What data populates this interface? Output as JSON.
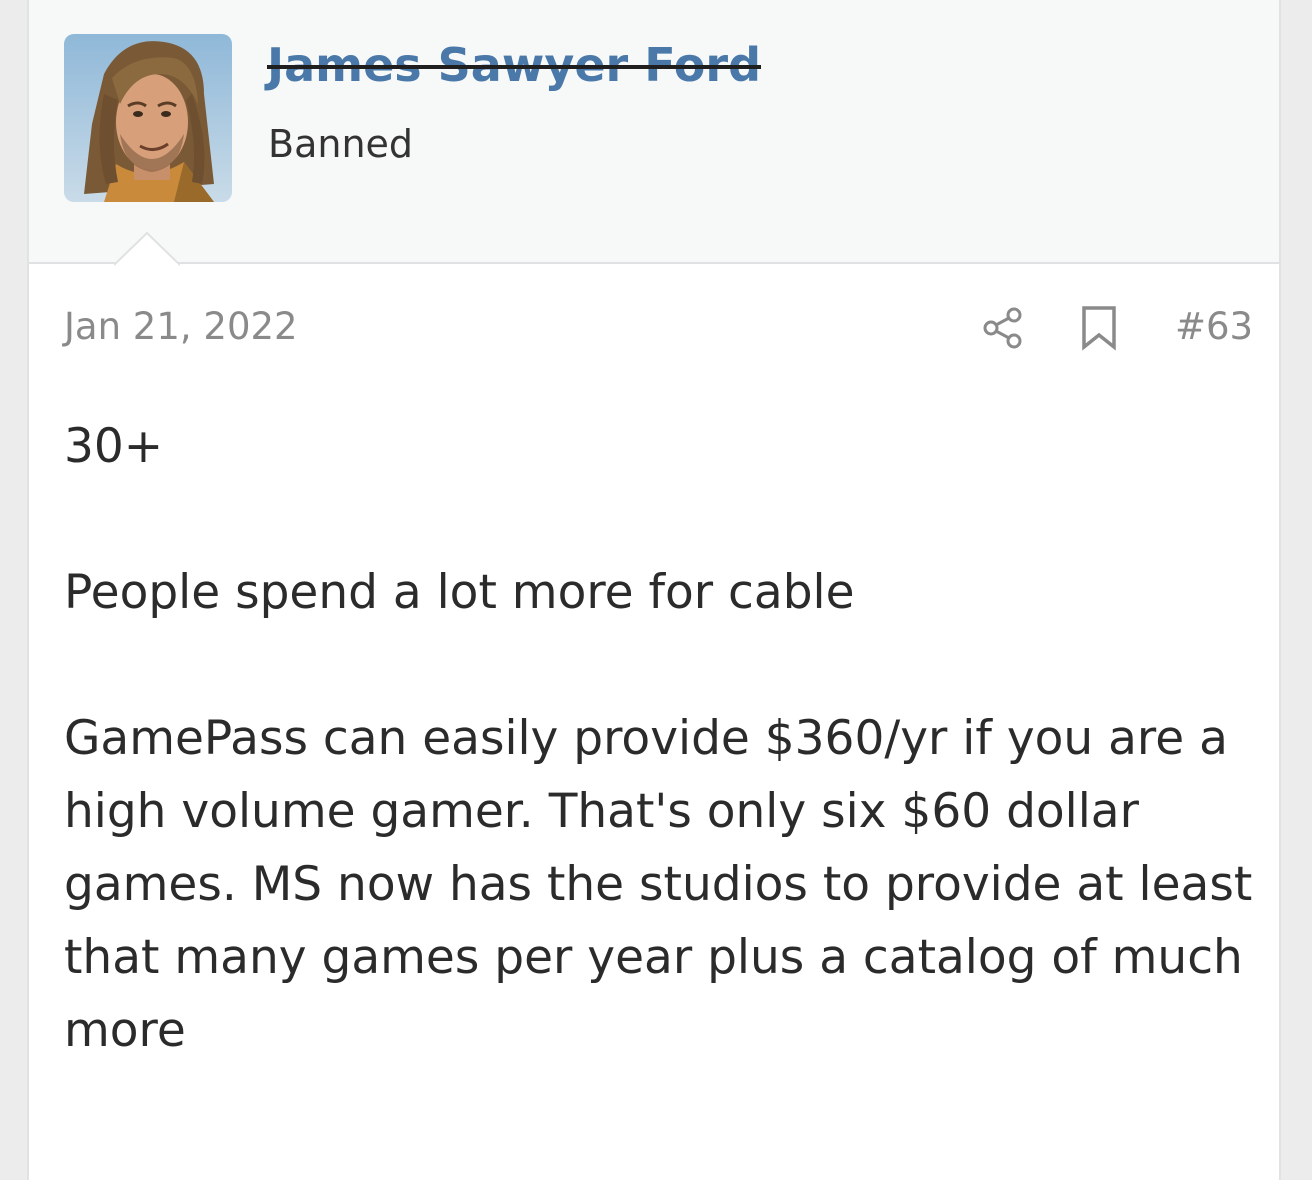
{
  "user": {
    "name": "James Sawyer Ford",
    "title": "Banned",
    "avatar_icon": "avatar-photo"
  },
  "post": {
    "date": "Jan 21, 2022",
    "number": "#63",
    "share_icon": "share-icon",
    "bookmark_icon": "bookmark-icon",
    "paragraphs": [
      "30+",
      "People spend a lot more for cable",
      "GamePass can easily provide $360/yr if you are a high volume gamer. That's only six $60 dollar games. MS now has the studios to provide at least that many games per year plus a catalog of much more"
    ]
  },
  "colors": {
    "username": "#4a78a8",
    "meta": "#8a8a8a",
    "text": "#2b2b2b",
    "header_bg": "#f7f8f8"
  }
}
